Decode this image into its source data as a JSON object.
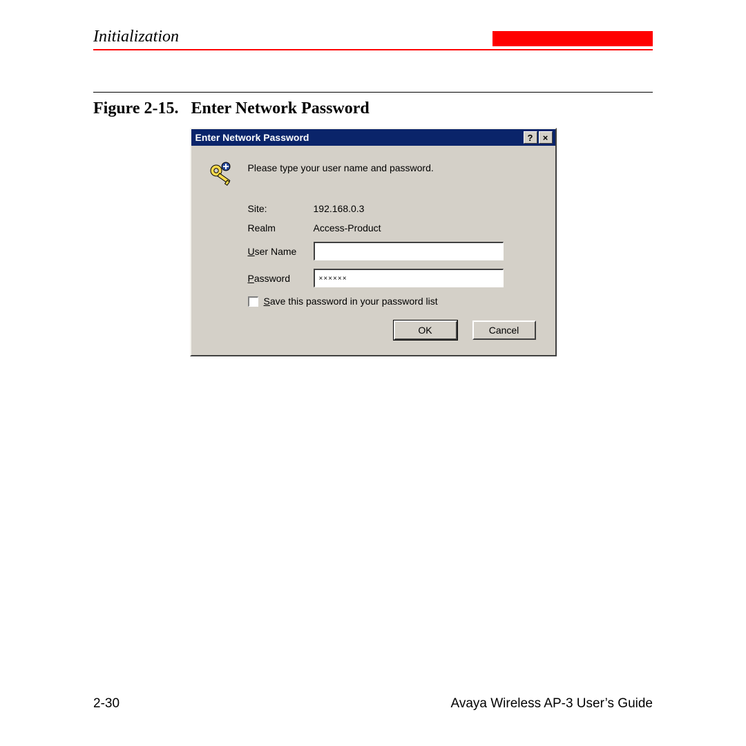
{
  "header": {
    "section": "Initialization"
  },
  "figure": {
    "label": "Figure 2-15.",
    "title": "Enter Network Password"
  },
  "dialog": {
    "title": "Enter Network Password",
    "help_symbol": "?",
    "close_symbol": "×",
    "instruction": "Please type your user name and password.",
    "site_label": "Site:",
    "site_value": "192.168.0.3",
    "realm_label": "Realm",
    "realm_value": "Access-Product",
    "username_label": "User Name",
    "username_value": "",
    "password_label": "Password",
    "password_value": "××××××",
    "save_label": "Save this password in your password list",
    "ok_label": "OK",
    "cancel_label": "Cancel"
  },
  "footer": {
    "page": "2-30",
    "guide": "Avaya Wireless AP-3 User’s Guide"
  }
}
